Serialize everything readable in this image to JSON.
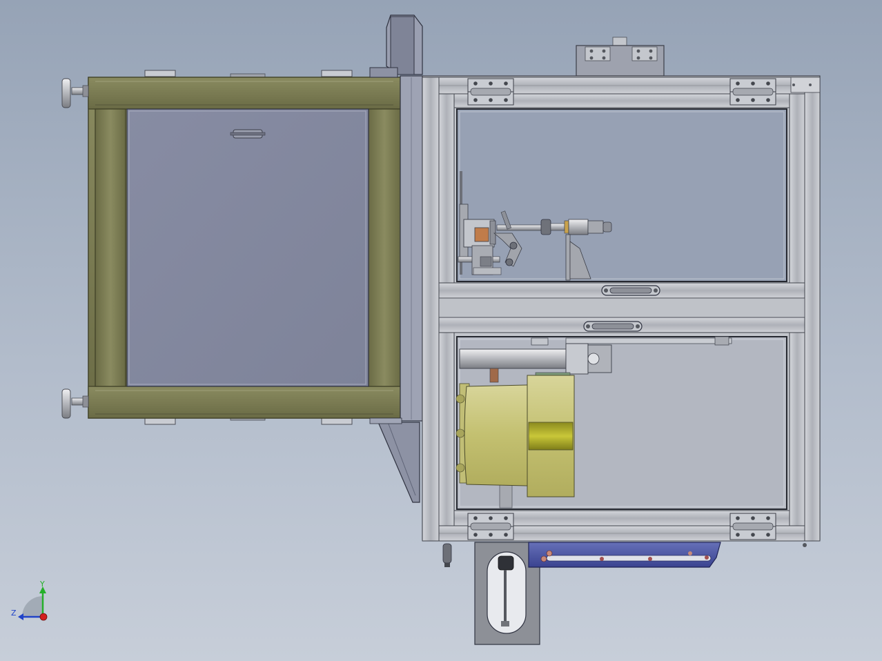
{
  "view": {
    "background_top": "#96a3b6",
    "background_bottom": "#c7ced9"
  },
  "colors": {
    "olive_frame": "#7c7d55",
    "olive_dark": "#45462b",
    "grey_panel": "#8489a0",
    "aluminium": "#b9bcc2",
    "aluminium_dark": "#6d7078",
    "yellow_part": "#c8c57c",
    "yellow_dark": "#a19f2a",
    "blue_bracket": "#4c57a3",
    "axis_x": "#d21f1f",
    "axis_y": "#25b02a",
    "axis_z": "#2043c8"
  },
  "axis_triad": {
    "y_label": "Y",
    "z_label": "Z"
  }
}
